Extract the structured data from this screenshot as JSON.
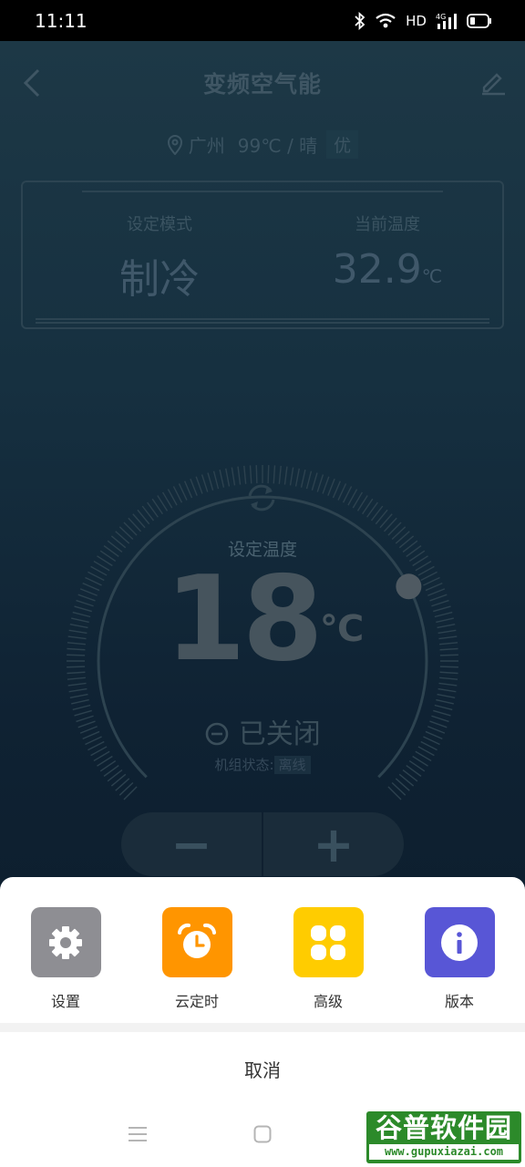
{
  "status_bar": {
    "time": "11:11",
    "network": "HD",
    "signal_label": "4G"
  },
  "header": {
    "title": "变频空气能"
  },
  "weather": {
    "city": "广州",
    "temp_weather": "99℃ / 晴",
    "aqi": "优"
  },
  "info": {
    "mode_label": "设定模式",
    "mode_value": "制冷",
    "temp_label": "当前温度",
    "temp_value": "32.9",
    "temp_unit": "℃"
  },
  "dial": {
    "label": "设定温度",
    "value": "18",
    "unit": "℃",
    "power_state": "已关闭",
    "unit_status_label": "机组状态:",
    "unit_status_value": "离线",
    "level_fraction": 0.95
  },
  "stepper": {
    "minus": "−",
    "plus": "+"
  },
  "sheet": {
    "actions": [
      {
        "label": "设置",
        "color": "#8e8e93",
        "icon": "gear-icon"
      },
      {
        "label": "云定时",
        "color": "#ff9500",
        "icon": "alarm-clock-icon"
      },
      {
        "label": "高级",
        "color": "#ffcc00",
        "icon": "clover-icon"
      },
      {
        "label": "版本",
        "color": "#5856d6",
        "icon": "info-icon"
      }
    ],
    "cancel": "取消"
  },
  "watermark": {
    "main": "谷普软件园",
    "sub": "www.gupuxiazai.com"
  }
}
